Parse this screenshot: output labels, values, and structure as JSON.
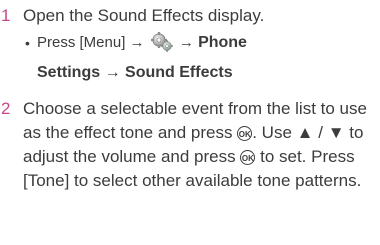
{
  "steps": [
    {
      "number": "1",
      "text": "Open the Sound Effects display.",
      "substeps": [
        {
          "bullet": "•",
          "press": "Press [Menu]",
          "arrow": "→",
          "icon": "settings-gears-icon",
          "item1": "Phone",
          "item2": "Settings",
          "item3": "Sound Effects"
        }
      ]
    },
    {
      "number": "2",
      "parts": {
        "a": "Choose a selectable event from the list to use as the effect tone and press",
        "ok1": "OK",
        "b": ". Use",
        "up": "▲",
        "slash": "/",
        "down": "▼",
        "c": "to adjust the volume and press",
        "ok2": "OK",
        "d": "to set. Press [Tone] to select other available tone patterns."
      }
    }
  ],
  "colors": {
    "step_number": "#c8478a",
    "text": "#3c3c3c"
  }
}
